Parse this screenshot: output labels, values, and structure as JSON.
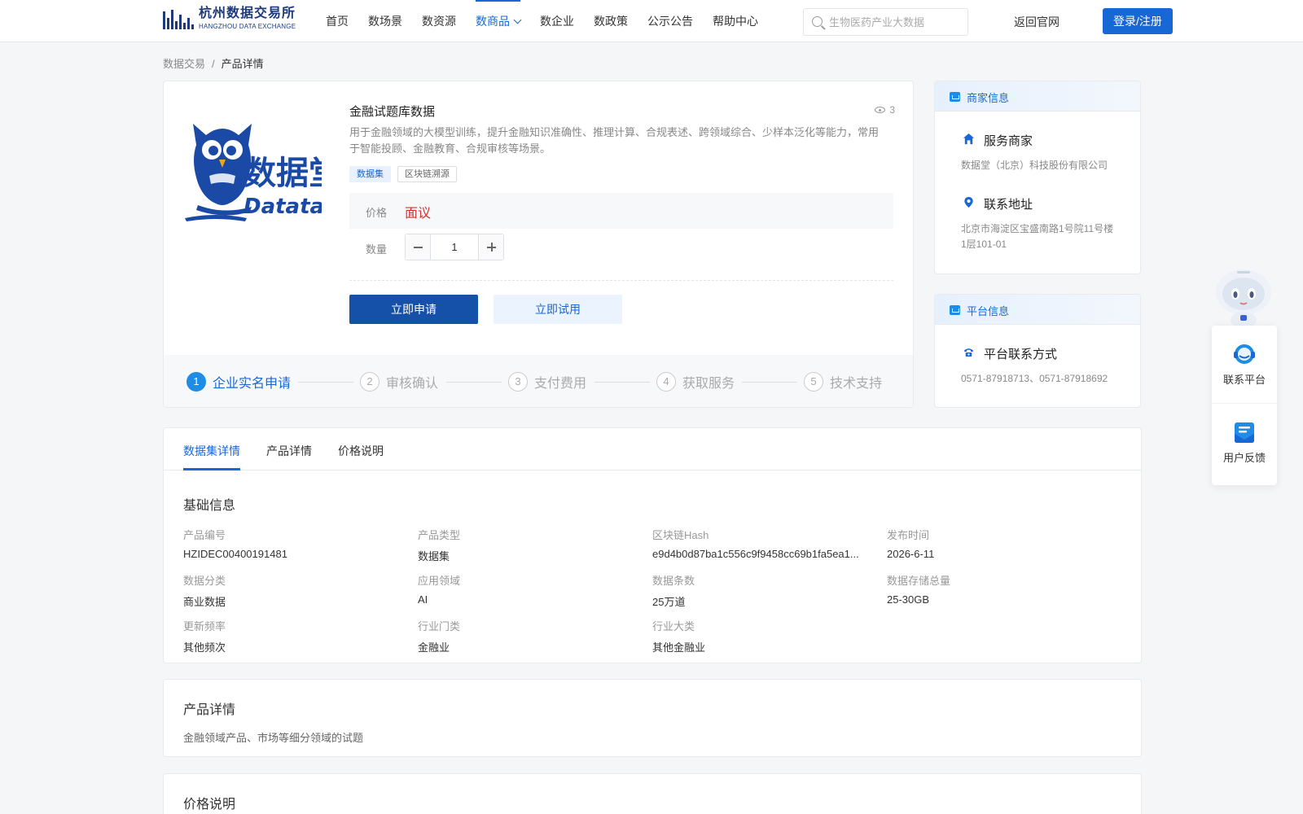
{
  "header": {
    "logo_cn": "杭州数据交易所",
    "logo_en": "HANGZHOU DATA EXCHANGE",
    "nav": [
      "首页",
      "数场景",
      "数资源",
      "数商品",
      "数企业",
      "数政策",
      "公示公告",
      "帮助中心"
    ],
    "active_nav": "数商品",
    "search_placeholder": "生物医药产业大数据",
    "back_link": "返回官网",
    "login": "登录/注册",
    "accent_color": "#1768d5"
  },
  "breadcrumb": {
    "root": "数据交易",
    "sep": "/",
    "current": "产品详情"
  },
  "product": {
    "logo_text": "数据堂",
    "logo_en": "Datatang",
    "title": "金融试题库数据",
    "views": "3",
    "desc": "用于金融领域的大模型训练，提升金融知识准确性、推理计算、合规表述、跨领域综合、少样本泛化等能力，常用于智能投顾、金融教育、合规审核等场景。",
    "tags": [
      "数据集",
      "区块链溯源"
    ],
    "price_label": "价格",
    "price_value": "面议",
    "price_color": "#d4322c",
    "qty_label": "数量",
    "qty_value": "1",
    "apply_btn": "立即申请",
    "trial_btn": "立即试用",
    "steps": [
      {
        "num": "1",
        "label": "企业实名申请"
      },
      {
        "num": "2",
        "label": "审核确认"
      },
      {
        "num": "3",
        "label": "支付费用"
      },
      {
        "num": "4",
        "label": "获取服务"
      },
      {
        "num": "5",
        "label": "技术支持"
      }
    ]
  },
  "merchant": {
    "header": "商家信息",
    "service_title": "服务商家",
    "service_value": "数据堂（北京）科技股份有限公司",
    "address_title": "联系地址",
    "address_value": "北京市海淀区宝盛南路1号院11号楼1层101-01"
  },
  "platform": {
    "header": "平台信息",
    "contact_title": "平台联系方式",
    "contact_value": "0571-87918713、0571-87918692"
  },
  "floating": {
    "contact": "联系平台",
    "feedback": "用户反馈"
  },
  "details": {
    "tabs": [
      "数据集详情",
      "产品详情",
      "价格说明"
    ],
    "basic_title": "基础信息",
    "fields": [
      {
        "label": "产品编号",
        "value": "HZIDEC00400191481"
      },
      {
        "label": "产品类型",
        "value": "数据集"
      },
      {
        "label": "区块链Hash",
        "value": "e9d4b0d87ba1c556c9f9458cc69b1fa5ea1..."
      },
      {
        "label": "发布时间",
        "value": "2026-6-11"
      },
      {
        "label": "数据分类",
        "value": "商业数据"
      },
      {
        "label": "应用领域",
        "value": "AI"
      },
      {
        "label": "数据条数",
        "value": "25万道"
      },
      {
        "label": "数据存储总量",
        "value": "25-30GB"
      },
      {
        "label": "更新频率",
        "value": "其他频次"
      },
      {
        "label": "行业门类",
        "value": "金融业"
      },
      {
        "label": "行业大类",
        "value": "其他金融业"
      }
    ],
    "product_detail_title": "产品详情",
    "product_detail_text": "金融领域产品、市场等细分领域的试题",
    "price_title": "价格说明"
  }
}
